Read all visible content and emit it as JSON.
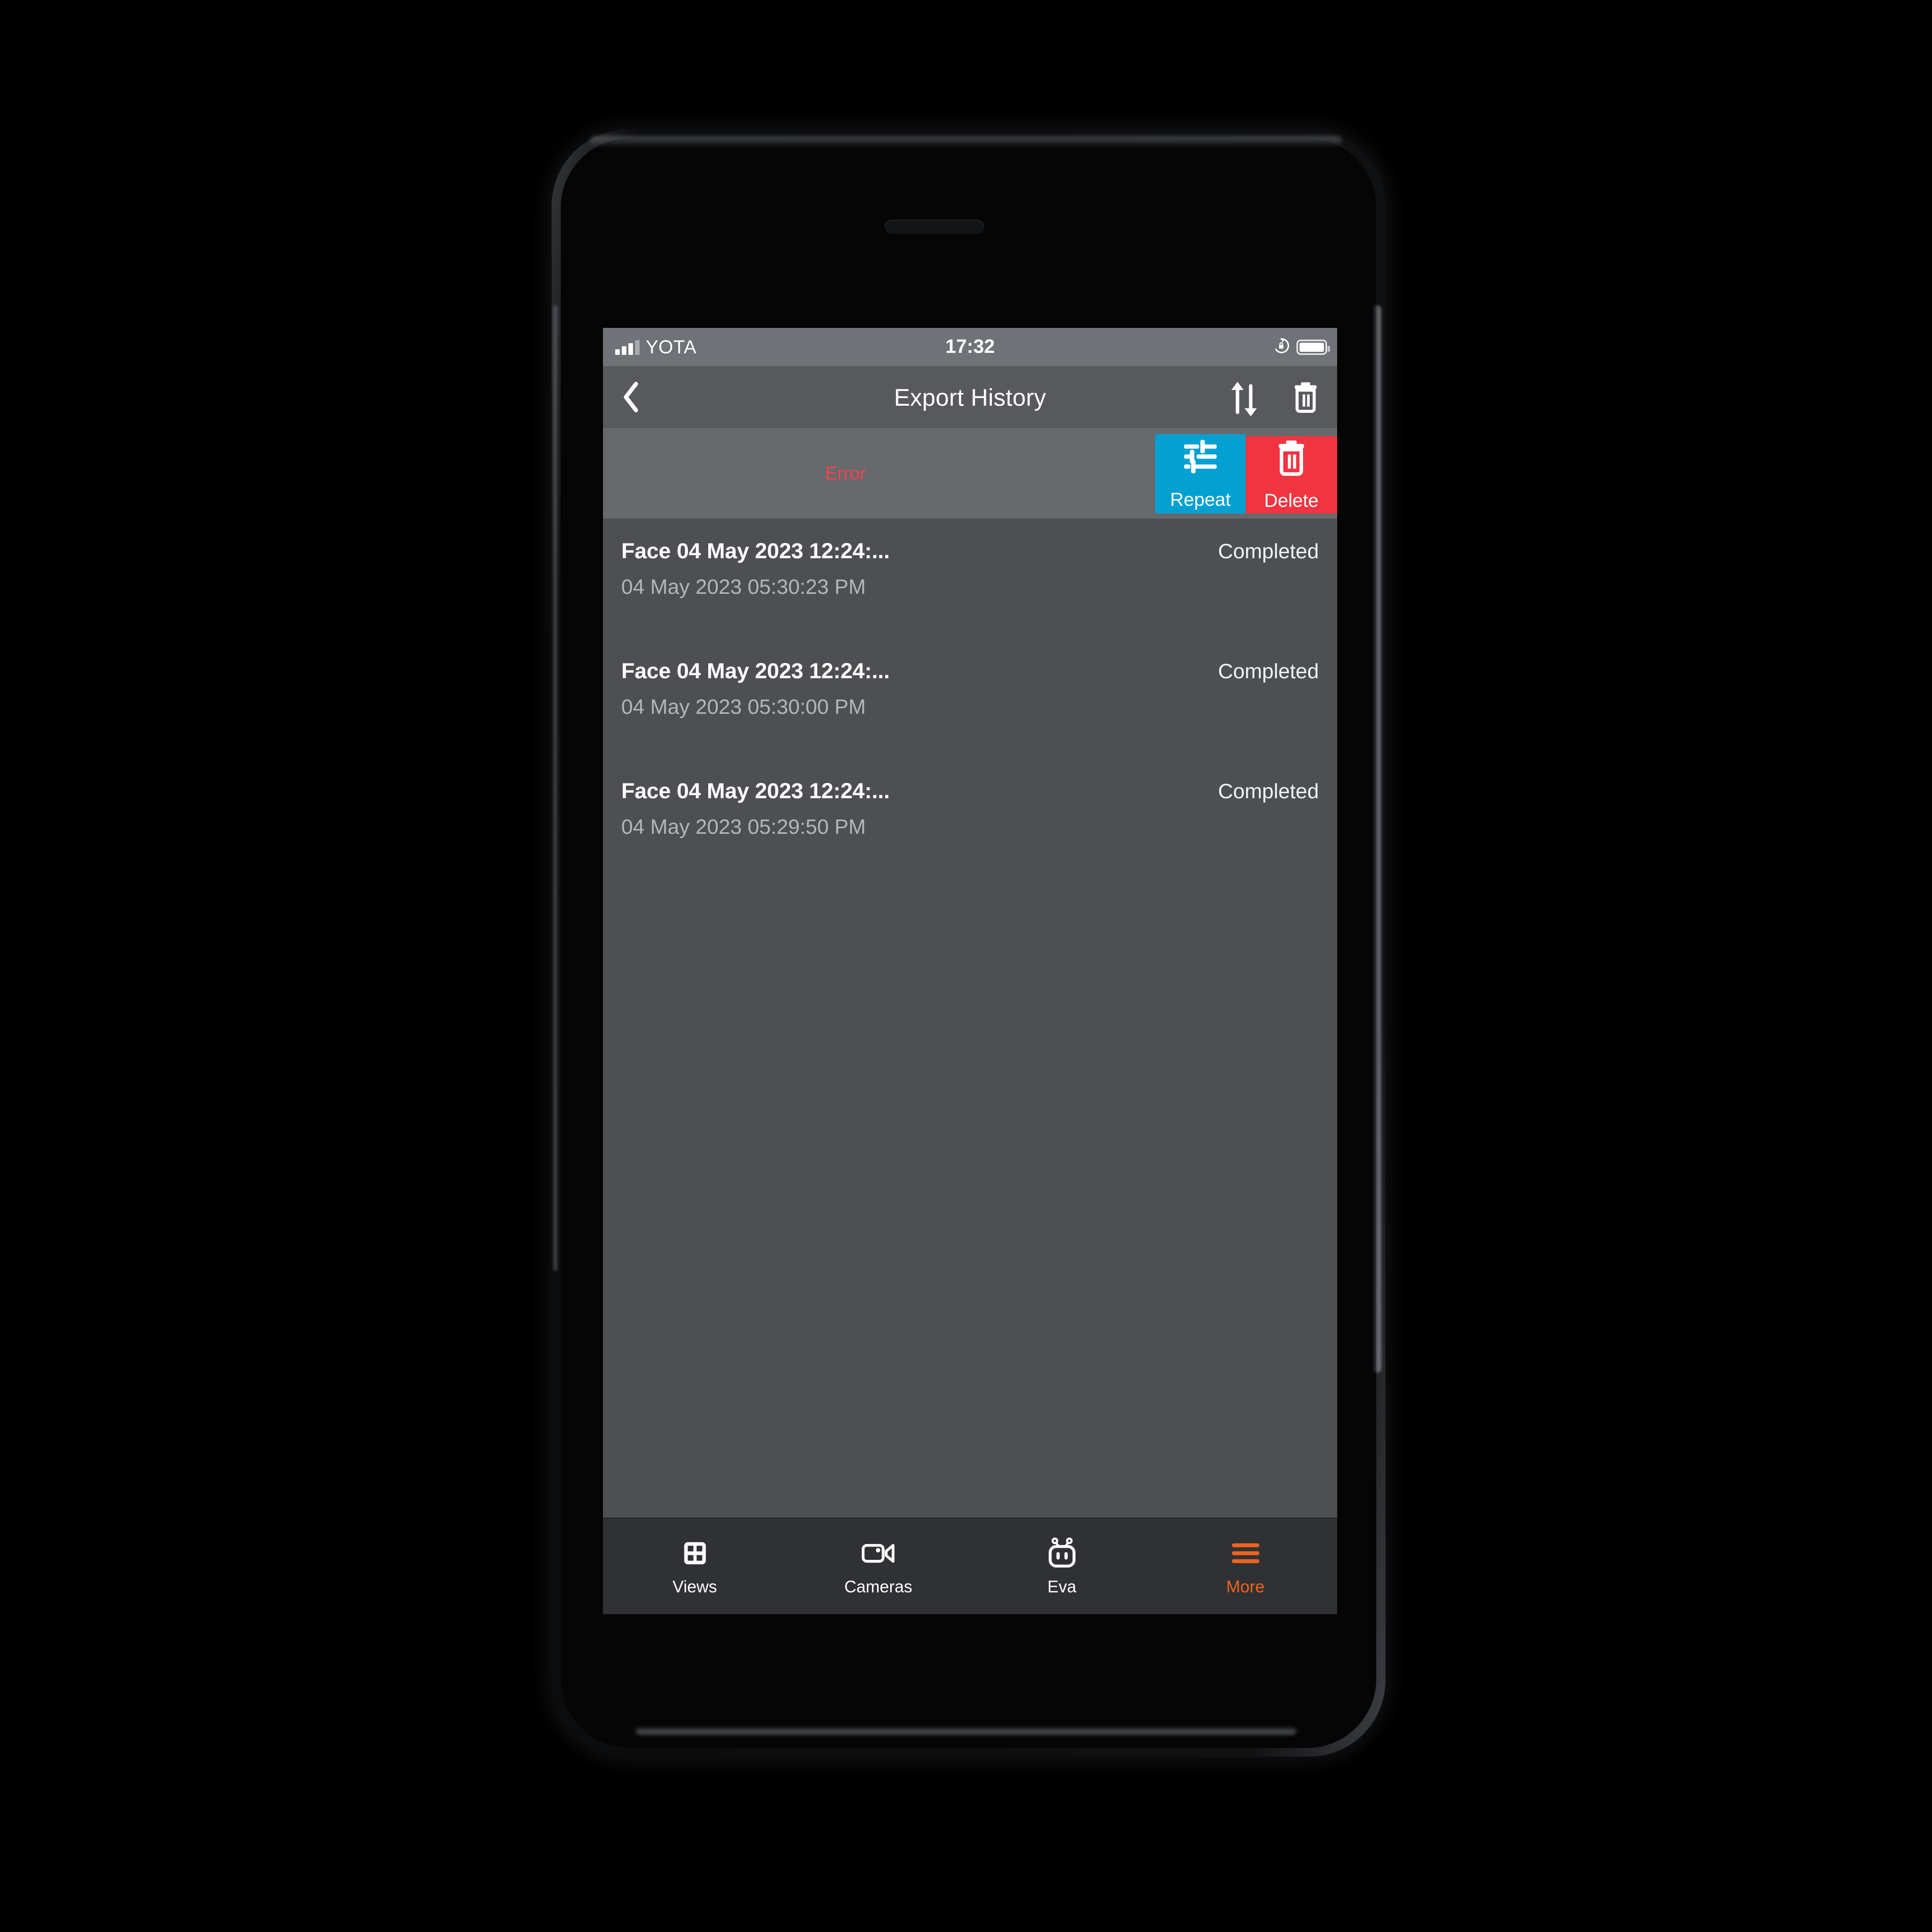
{
  "status_bar": {
    "carrier": "YOTA",
    "time": "17:32",
    "signal_icon": "signal-bars-icon",
    "rotation_lock_icon": "rotation-lock-icon",
    "battery_icon": "battery-full-icon"
  },
  "nav_bar": {
    "back_icon": "chevron-left-icon",
    "title": "Export History",
    "sort_icon": "sort-arrows-icon",
    "delete_icon": "trash-icon"
  },
  "swipe_row": {
    "error_label": "Error",
    "repeat": {
      "label": "Repeat",
      "icon": "sliders-icon",
      "color": "#03a0d2"
    },
    "delete": {
      "label": "Delete",
      "icon": "trash-icon",
      "color": "#f1343f"
    }
  },
  "list": {
    "items": [
      {
        "title": "Face 04 May 2023 12:24:...",
        "status": "Completed",
        "timestamp": "04 May 2023 05:30:23 PM"
      },
      {
        "title": "Face 04 May 2023 12:24:...",
        "status": "Completed",
        "timestamp": "04 May 2023 05:30:00 PM"
      },
      {
        "title": "Face 04 May 2023 12:24:...",
        "status": "Completed",
        "timestamp": "04 May 2023 05:29:50 PM"
      }
    ]
  },
  "tab_bar": {
    "active_color": "#ee641d",
    "tabs": [
      {
        "label": "Views",
        "icon": "grid-icon",
        "active": false
      },
      {
        "label": "Cameras",
        "icon": "video-camera-icon",
        "active": false
      },
      {
        "label": "Eva",
        "icon": "robot-icon",
        "active": false
      },
      {
        "label": "More",
        "icon": "hamburger-menu-icon",
        "active": true
      }
    ]
  },
  "colors": {
    "screen_bg": "#4d4f53",
    "navbar_bg": "#58595d",
    "statusbar_bg": "#6f7276",
    "swipe_row_bg": "#67696d",
    "tabbar_bg": "#2f3134",
    "error_red": "#f0454f",
    "accent_orange": "#ee641d",
    "repeat_blue": "#03a0d2",
    "delete_red": "#f1343f"
  }
}
